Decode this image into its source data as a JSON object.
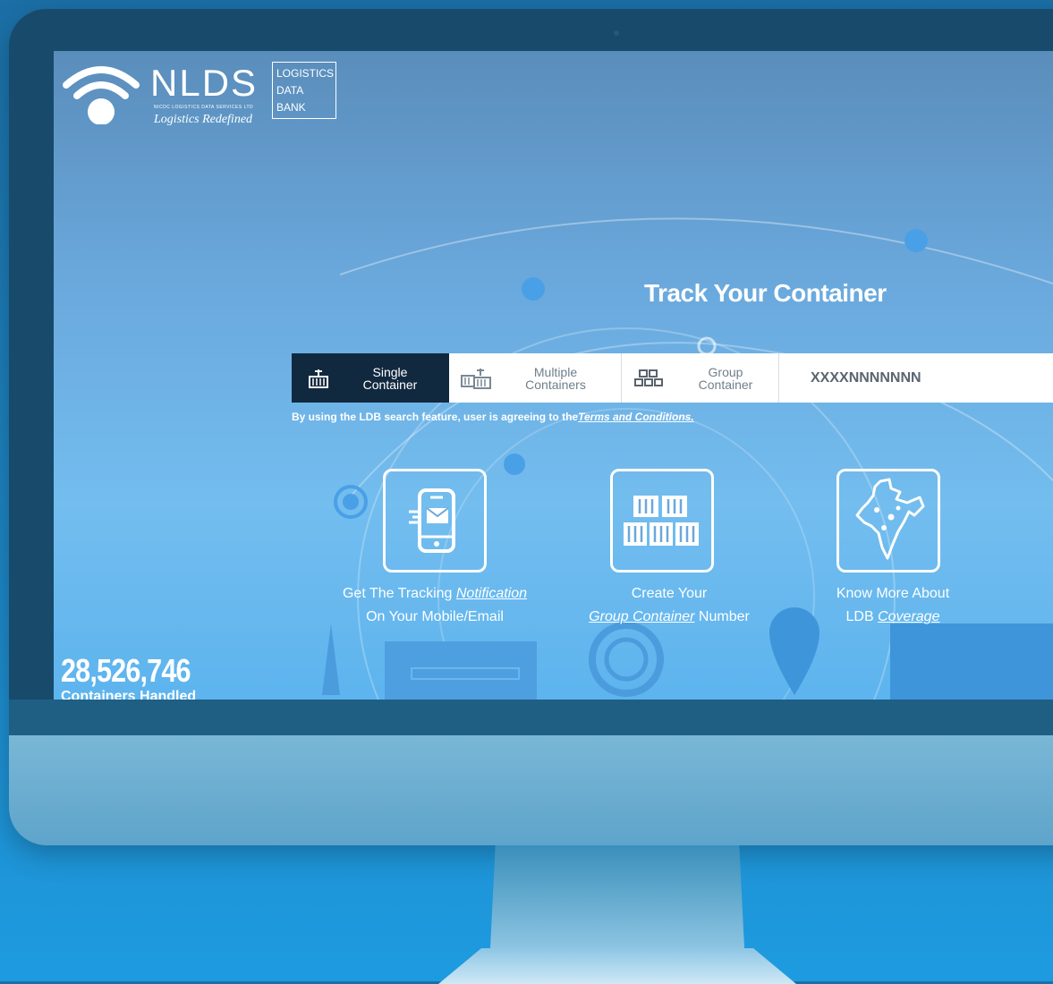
{
  "logo": {
    "name": "NLDS",
    "subtext": "NICDC LOGISTICS DATA SERVICES LTD",
    "tagline": "Logistics Redefined",
    "ldb_line1": "LOGISTICS",
    "ldb_line2": "DATA",
    "ldb_line3": "BANK"
  },
  "hero": {
    "title": "Track Your Container"
  },
  "tabs": [
    {
      "label": "Single\nContainer",
      "icon": "container-crane-icon",
      "active": true
    },
    {
      "label": "Multiple\nContainers",
      "icon": "multiple-containers-icon",
      "active": false
    },
    {
      "label": "Group\nContainer",
      "icon": "group-container-icon",
      "active": false
    }
  ],
  "search": {
    "placeholder": "XXXXNNNNNNN"
  },
  "disclaimer": {
    "text": "By using the LDB search feature, user is agreeing to the",
    "link": "Terms and Conditions."
  },
  "features": [
    {
      "line1_prefix": "Get The Tracking ",
      "line1_link": "Notification",
      "line2": "On Your Mobile/Email",
      "icon": "mobile-notification-icon"
    },
    {
      "line1": "Create Your",
      "line2_link": "Group Container",
      "line2_suffix": " Number",
      "icon": "container-stack-icon"
    },
    {
      "line1": "Know More About",
      "line2_prefix": "LDB ",
      "line2_link": "Coverage",
      "icon": "india-map-icon"
    }
  ],
  "stats": {
    "count": "28,526,746",
    "label": "Containers Handled"
  },
  "colors": {
    "tab_active_bg": "#11293f",
    "screen_blue": "#6aa8dc",
    "bezel": "#174a6b"
  }
}
